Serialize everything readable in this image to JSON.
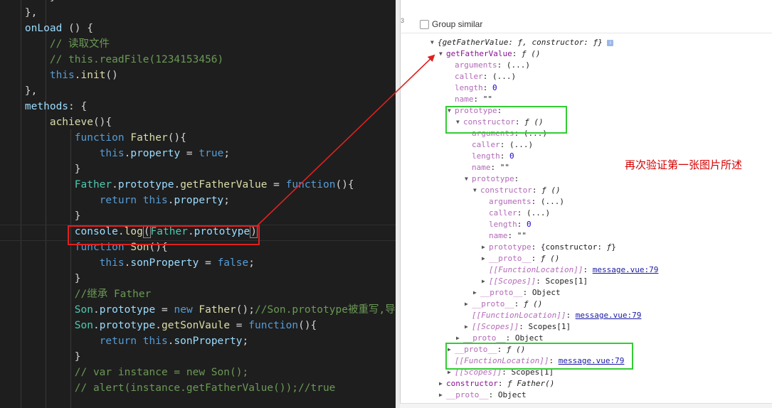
{
  "editor": {
    "lines": [
      [
        {
          "t": "        }",
          "c": "pl"
        }
      ],
      [
        {
          "t": "    },",
          "c": "pl"
        }
      ],
      [
        {
          "t": "    onLoad ",
          "c": "p"
        },
        {
          "t": "() {",
          "c": "pl"
        }
      ],
      [
        {
          "t": "        // 读取文件",
          "c": "c"
        }
      ],
      [
        {
          "t": "        // this.readFile(1234153456)",
          "c": "c"
        }
      ],
      [
        {
          "t": "        ",
          "c": "pl"
        },
        {
          "t": "this",
          "c": "k"
        },
        {
          "t": ".",
          "c": "pl"
        },
        {
          "t": "init",
          "c": "f"
        },
        {
          "t": "()",
          "c": "pl"
        }
      ],
      [
        {
          "t": "    },",
          "c": "pl"
        }
      ],
      [
        {
          "t": "    methods",
          "c": "p"
        },
        {
          "t": ": {",
          "c": "pl"
        }
      ],
      [
        {
          "t": "        ",
          "c": "pl"
        },
        {
          "t": "achieve",
          "c": "f"
        },
        {
          "t": "(){",
          "c": "pl"
        }
      ],
      [
        {
          "t": "            ",
          "c": "pl"
        },
        {
          "t": "function ",
          "c": "k"
        },
        {
          "t": "Father",
          "c": "f"
        },
        {
          "t": "(){",
          "c": "pl"
        }
      ],
      [
        {
          "t": "                ",
          "c": "pl"
        },
        {
          "t": "this",
          "c": "k"
        },
        {
          "t": ".",
          "c": "pl"
        },
        {
          "t": "property",
          "c": "p"
        },
        {
          "t": " = ",
          "c": "pl"
        },
        {
          "t": "true",
          "c": "k"
        },
        {
          "t": ";",
          "c": "pl"
        }
      ],
      [
        {
          "t": "            }",
          "c": "pl"
        }
      ],
      [
        {
          "t": "            ",
          "c": "pl"
        },
        {
          "t": "Father",
          "c": "t"
        },
        {
          "t": ".",
          "c": "pl"
        },
        {
          "t": "prototype",
          "c": "p"
        },
        {
          "t": ".",
          "c": "pl"
        },
        {
          "t": "getFatherValue",
          "c": "f"
        },
        {
          "t": " = ",
          "c": "pl"
        },
        {
          "t": "function",
          "c": "k"
        },
        {
          "t": "(){",
          "c": "pl"
        }
      ],
      [
        {
          "t": "                ",
          "c": "pl"
        },
        {
          "t": "return ",
          "c": "k"
        },
        {
          "t": "this",
          "c": "k"
        },
        {
          "t": ".",
          "c": "pl"
        },
        {
          "t": "property",
          "c": "p"
        },
        {
          "t": ";",
          "c": "pl"
        }
      ],
      [
        {
          "t": "            }",
          "c": "pl"
        }
      ],
      [
        {
          "t": "            ",
          "c": "pl"
        },
        {
          "t": "console",
          "c": "p"
        },
        {
          "t": ".",
          "c": "pl"
        },
        {
          "t": "log",
          "c": "f"
        },
        {
          "t": "(",
          "c": "pl hl"
        },
        {
          "t": "Father",
          "c": "t"
        },
        {
          "t": ".",
          "c": "pl"
        },
        {
          "t": "prototype",
          "c": "p"
        },
        {
          "t": ")",
          "c": "pl hl"
        }
      ],
      [
        {
          "t": "            ",
          "c": "pl"
        },
        {
          "t": "function ",
          "c": "k"
        },
        {
          "t": "Son",
          "c": "f"
        },
        {
          "t": "(){",
          "c": "pl"
        }
      ],
      [
        {
          "t": "                ",
          "c": "pl"
        },
        {
          "t": "this",
          "c": "k"
        },
        {
          "t": ".",
          "c": "pl"
        },
        {
          "t": "sonProperty",
          "c": "p"
        },
        {
          "t": " = ",
          "c": "pl"
        },
        {
          "t": "false",
          "c": "k"
        },
        {
          "t": ";",
          "c": "pl"
        }
      ],
      [
        {
          "t": "            }",
          "c": "pl"
        }
      ],
      [
        {
          "t": "            //继承 Father",
          "c": "c"
        }
      ],
      [
        {
          "t": "            ",
          "c": "pl"
        },
        {
          "t": "Son",
          "c": "t"
        },
        {
          "t": ".",
          "c": "pl"
        },
        {
          "t": "prototype",
          "c": "p"
        },
        {
          "t": " = ",
          "c": "pl"
        },
        {
          "t": "new ",
          "c": "k"
        },
        {
          "t": "Father",
          "c": "f"
        },
        {
          "t": "();",
          "c": "pl"
        },
        {
          "t": "//Son.prototype被重写,导",
          "c": "c"
        }
      ],
      [
        {
          "t": "            ",
          "c": "pl"
        },
        {
          "t": "Son",
          "c": "t"
        },
        {
          "t": ".",
          "c": "pl"
        },
        {
          "t": "prototype",
          "c": "p"
        },
        {
          "t": ".",
          "c": "pl"
        },
        {
          "t": "getSonVaule",
          "c": "f"
        },
        {
          "t": " = ",
          "c": "pl"
        },
        {
          "t": "function",
          "c": "k"
        },
        {
          "t": "(){",
          "c": "pl"
        }
      ],
      [
        {
          "t": "                ",
          "c": "pl"
        },
        {
          "t": "return ",
          "c": "k"
        },
        {
          "t": "this",
          "c": "k"
        },
        {
          "t": ".",
          "c": "pl"
        },
        {
          "t": "sonProperty",
          "c": "p"
        },
        {
          "t": ";",
          "c": "pl"
        }
      ],
      [
        {
          "t": "            }",
          "c": "pl"
        }
      ],
      [
        {
          "t": "            // var instance = new Son();",
          "c": "c"
        }
      ],
      [
        {
          "t": "            // alert(instance.getFatherValue());//true",
          "c": "c"
        }
      ]
    ]
  },
  "devtools": {
    "line_number": "3",
    "group_similar_label": "Group similar",
    "note": "再次验证第一张图片所述",
    "tree": [
      {
        "lvl": 0,
        "tri": "open",
        "parts": [
          {
            "t": "{getFatherValue: ",
            "c": "ic"
          },
          {
            "t": "ƒ",
            "c": "ic"
          },
          {
            "t": ", constructor: ",
            "c": "ic"
          },
          {
            "t": "ƒ",
            "c": "ic"
          },
          {
            "t": "} ",
            "c": "ic"
          },
          {
            "t": "i",
            "c": "info"
          }
        ]
      },
      {
        "lvl": 1,
        "tri": "open",
        "parts": [
          {
            "t": "getFatherValue",
            "c": "key"
          },
          {
            "t": ": ",
            "c": "val"
          },
          {
            "t": "ƒ ()",
            "c": "fn"
          }
        ]
      },
      {
        "lvl": 2,
        "tri": "",
        "parts": [
          {
            "t": "arguments",
            "c": "dim"
          },
          {
            "t": ": (...)",
            "c": "val"
          }
        ]
      },
      {
        "lvl": 2,
        "tri": "",
        "parts": [
          {
            "t": "caller",
            "c": "dim"
          },
          {
            "t": ": (...)",
            "c": "val"
          }
        ]
      },
      {
        "lvl": 2,
        "tri": "",
        "parts": [
          {
            "t": "length",
            "c": "dim"
          },
          {
            "t": ": ",
            "c": "val"
          },
          {
            "t": "0",
            "c": "num"
          }
        ]
      },
      {
        "lvl": 2,
        "tri": "",
        "parts": [
          {
            "t": "name",
            "c": "dim"
          },
          {
            "t": ": \"\"",
            "c": "val"
          }
        ]
      },
      {
        "lvl": 2,
        "tri": "open",
        "parts": [
          {
            "t": "prototype",
            "c": "dim"
          },
          {
            "t": ":",
            "c": "val"
          }
        ]
      },
      {
        "lvl": 3,
        "tri": "open",
        "parts": [
          {
            "t": "constructor",
            "c": "dim"
          },
          {
            "t": ": ",
            "c": "val"
          },
          {
            "t": "ƒ ()",
            "c": "fn"
          }
        ]
      },
      {
        "lvl": 4,
        "tri": "",
        "parts": [
          {
            "t": "arguments",
            "c": "dim"
          },
          {
            "t": ": (...)",
            "c": "val"
          }
        ]
      },
      {
        "lvl": 4,
        "tri": "",
        "parts": [
          {
            "t": "caller",
            "c": "dim"
          },
          {
            "t": ": (...)",
            "c": "val"
          }
        ]
      },
      {
        "lvl": 4,
        "tri": "",
        "parts": [
          {
            "t": "length",
            "c": "dim"
          },
          {
            "t": ": ",
            "c": "val"
          },
          {
            "t": "0",
            "c": "num"
          }
        ]
      },
      {
        "lvl": 4,
        "tri": "",
        "parts": [
          {
            "t": "name",
            "c": "dim"
          },
          {
            "t": ": \"\"",
            "c": "val"
          }
        ]
      },
      {
        "lvl": 4,
        "tri": "open",
        "parts": [
          {
            "t": "prototype",
            "c": "dim"
          },
          {
            "t": ":",
            "c": "val"
          }
        ]
      },
      {
        "lvl": 5,
        "tri": "open",
        "parts": [
          {
            "t": "constructor",
            "c": "dim"
          },
          {
            "t": ": ",
            "c": "val"
          },
          {
            "t": "ƒ ()",
            "c": "fn"
          }
        ]
      },
      {
        "lvl": 6,
        "tri": "",
        "parts": [
          {
            "t": "arguments",
            "c": "dim"
          },
          {
            "t": ": (...)",
            "c": "val"
          }
        ]
      },
      {
        "lvl": 6,
        "tri": "",
        "parts": [
          {
            "t": "caller",
            "c": "dim"
          },
          {
            "t": ": (...)",
            "c": "val"
          }
        ]
      },
      {
        "lvl": 6,
        "tri": "",
        "parts": [
          {
            "t": "length",
            "c": "dim"
          },
          {
            "t": ": ",
            "c": "val"
          },
          {
            "t": "0",
            "c": "num"
          }
        ]
      },
      {
        "lvl": 6,
        "tri": "",
        "parts": [
          {
            "t": "name",
            "c": "dim"
          },
          {
            "t": ": \"\"",
            "c": "val"
          }
        ]
      },
      {
        "lvl": 6,
        "tri": "closed",
        "parts": [
          {
            "t": "prototype",
            "c": "dim"
          },
          {
            "t": ": {constructor: ",
            "c": "val"
          },
          {
            "t": "ƒ",
            "c": "fn"
          },
          {
            "t": "}",
            "c": "val"
          }
        ]
      },
      {
        "lvl": 6,
        "tri": "closed",
        "parts": [
          {
            "t": "__proto__",
            "c": "dim"
          },
          {
            "t": ": ",
            "c": "val"
          },
          {
            "t": "ƒ ()",
            "c": "fn"
          }
        ]
      },
      {
        "lvl": 6,
        "tri": "",
        "parts": [
          {
            "t": "[[FunctionLocation]]",
            "c": "dim ic"
          },
          {
            "t": ": ",
            "c": "val"
          },
          {
            "t": "message.vue:79",
            "c": "lk"
          }
        ]
      },
      {
        "lvl": 6,
        "tri": "closed",
        "parts": [
          {
            "t": "[[Scopes]]",
            "c": "dim ic"
          },
          {
            "t": ": Scopes[1]",
            "c": "val"
          }
        ]
      },
      {
        "lvl": 5,
        "tri": "closed",
        "parts": [
          {
            "t": "__proto__",
            "c": "dim"
          },
          {
            "t": ": Object",
            "c": "val"
          }
        ]
      },
      {
        "lvl": 4,
        "tri": "closed",
        "parts": [
          {
            "t": "__proto__",
            "c": "dim"
          },
          {
            "t": ": ",
            "c": "val"
          },
          {
            "t": "ƒ ()",
            "c": "fn"
          }
        ]
      },
      {
        "lvl": 4,
        "tri": "",
        "parts": [
          {
            "t": "[[FunctionLocation]]",
            "c": "dim ic"
          },
          {
            "t": ": ",
            "c": "val"
          },
          {
            "t": "message.vue:79",
            "c": "lk"
          }
        ]
      },
      {
        "lvl": 4,
        "tri": "closed",
        "parts": [
          {
            "t": "[[Scopes]]",
            "c": "dim ic"
          },
          {
            "t": ": Scopes[1]",
            "c": "val"
          }
        ]
      },
      {
        "lvl": 3,
        "tri": "closed",
        "parts": [
          {
            "t": "__proto__",
            "c": "dim"
          },
          {
            "t": ": Object",
            "c": "val"
          }
        ]
      },
      {
        "lvl": 2,
        "tri": "closed",
        "parts": [
          {
            "t": "__proto__",
            "c": "dim"
          },
          {
            "t": ": ",
            "c": "val"
          },
          {
            "t": "ƒ ()",
            "c": "fn"
          }
        ]
      },
      {
        "lvl": 2,
        "tri": "",
        "parts": [
          {
            "t": "[[FunctionLocation]]",
            "c": "dim ic"
          },
          {
            "t": ": ",
            "c": "val"
          },
          {
            "t": "message.vue:79",
            "c": "lk"
          }
        ]
      },
      {
        "lvl": 2,
        "tri": "closed",
        "parts": [
          {
            "t": "[[Scopes]]",
            "c": "dim ic"
          },
          {
            "t": ": Scopes[1]",
            "c": "val"
          }
        ]
      },
      {
        "lvl": 1,
        "tri": "closed",
        "parts": [
          {
            "t": "constructor",
            "c": "key"
          },
          {
            "t": ": ",
            "c": "val"
          },
          {
            "t": "ƒ Father()",
            "c": "fn"
          }
        ]
      },
      {
        "lvl": 1,
        "tri": "closed",
        "parts": [
          {
            "t": "__proto__",
            "c": "dim"
          },
          {
            "t": ": Object",
            "c": "val"
          }
        ]
      }
    ]
  },
  "colors": {
    "annotation_red": "#e02020",
    "annotation_green": "#33cc33",
    "editor_bg": "#1e1e1e"
  }
}
